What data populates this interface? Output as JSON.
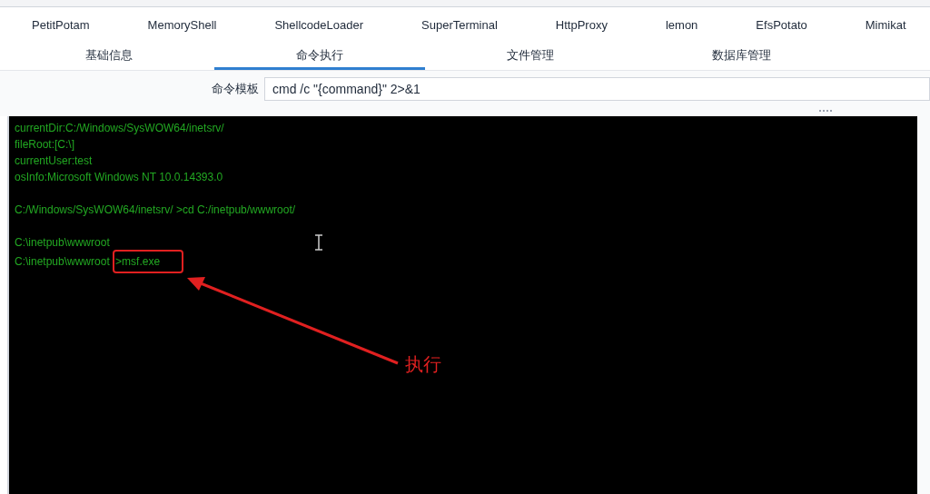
{
  "plugin_tabs": [
    "PetitPotam",
    "MemoryShell",
    "ShellcodeLoader",
    "SuperTerminal",
    "HttpProxy",
    "lemon",
    "EfsPotato",
    "Mimikat"
  ],
  "main_tabs": [
    {
      "label": "基础信息",
      "selected": false
    },
    {
      "label": "命令执行",
      "selected": true
    },
    {
      "label": "文件管理",
      "selected": false
    },
    {
      "label": "数据库管理",
      "selected": false
    }
  ],
  "command_template": {
    "label": "命令模板",
    "value": "cmd /c \"{command}\" 2>&1"
  },
  "terminal": {
    "blocks": [
      [
        "currentDir:C:/Windows/SysWOW64/inetsrv/",
        "fileRoot:[C:\\]",
        "currentUser:test",
        "osInfo:Microsoft Windows NT 10.0.14393.0"
      ],
      [
        "C:/Windows/SysWOW64/inetsrv/ >cd C:/inetpub/wwwroot/"
      ],
      [
        "C:\\inetpub\\wwwroot"
      ]
    ],
    "prompt": "C:\\inetpub\\wwwroot ",
    "input": ">msf.exe"
  },
  "annotation": {
    "label": "执行"
  }
}
